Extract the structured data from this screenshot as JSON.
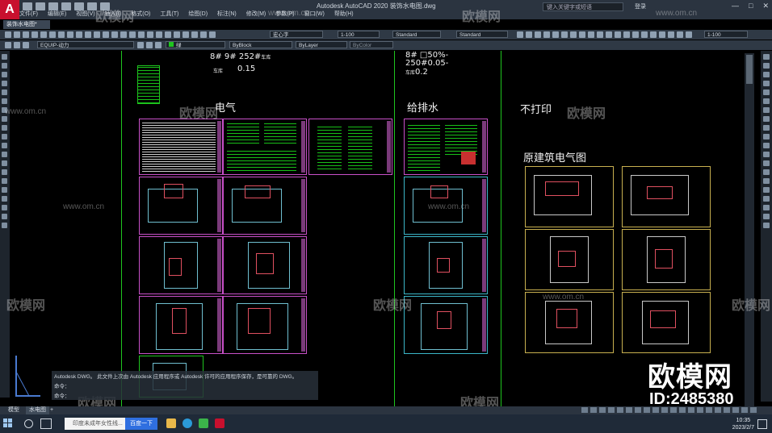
{
  "app": {
    "logo": "A",
    "title": "Autodesk AutoCAD 2020   装饰水电图.dwg",
    "menus": [
      "文件(F)",
      "编辑(E)",
      "视图(V)",
      "插入(I)",
      "格式(O)",
      "工具(T)",
      "绘图(D)",
      "标注(N)",
      "修改(M)",
      "参数(P)",
      "窗口(W)",
      "帮助(H)"
    ],
    "search_placeholder": "键入关键字或短语",
    "login_label": "登录",
    "doc_tab": "装饰水电图*"
  },
  "toolbar": {
    "text_style": "宏心字",
    "scale1": "1-100",
    "dim_style": "Standard",
    "table_style": "Standard",
    "scale2": "1-100",
    "layer": "EQUIP-动力",
    "color_label": "绿",
    "linetype": "ByBlock",
    "lineweight": "ByLayer",
    "plot_style": "ByColor"
  },
  "drawing": {
    "label_dianqi": "电气",
    "label_geipaishui": "给排水",
    "label_budayin": "不打印",
    "label_yuanjianzhu": "原建筑电气图",
    "note_line1": "8# 9# 252#",
    "note_line1_suffix": "车库",
    "note_hmm": "0.15",
    "note_prefix": "车库",
    "note_right1": "8#  □50%-",
    "note_right2": "250#0.05-",
    "note_right3": "0.2",
    "note_right3_prefix": "车库"
  },
  "command": {
    "line1": "Autodesk DWG。  此文件上次由 Autodesk 应用程序或 Autodesk 许可的应用程序保存，是可靠的 DWG。",
    "line2": "命令：",
    "line3": "命令："
  },
  "layout_tabs": {
    "model": "模型",
    "layout": "水电图"
  },
  "taskbar": {
    "search_text": "印度未成年女性线...",
    "search_button": "百度一下",
    "time": "10:35",
    "date": "2023/2/7"
  },
  "watermark": {
    "text": "欧模网",
    "url": "www.om.cn",
    "brand": "欧模网",
    "id": "ID:2485380"
  }
}
